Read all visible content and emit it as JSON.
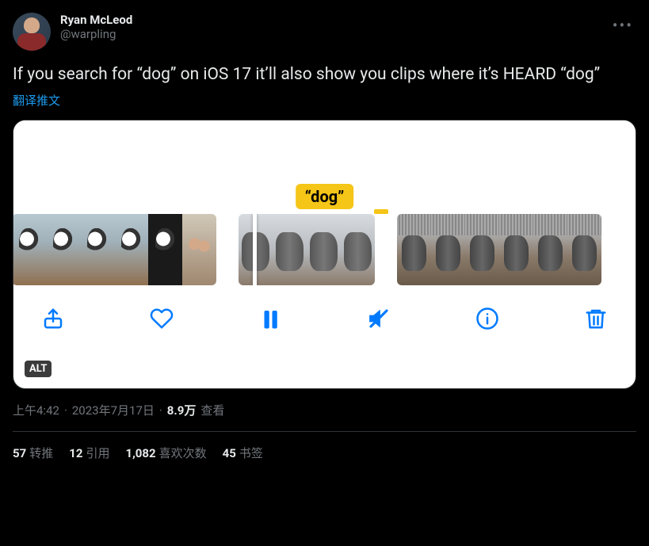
{
  "user": {
    "display_name": "Ryan McLeod",
    "handle": "@warpling"
  },
  "tweet_text": "If you search for “dog” on iOS 17 it’ll also show you clips where it’s HEARD “dog”",
  "translate_label": "翻译推文",
  "media": {
    "caption_tag": "“dog”",
    "alt_badge": "ALT"
  },
  "meta": {
    "time": "上午4:42",
    "separator1": " · ",
    "date": "2023年7月17日",
    "separator2": " · ",
    "views_count": "8.9万",
    "views_label": " 查看"
  },
  "stats": {
    "retweets": {
      "count": "57",
      "label": "转推"
    },
    "quotes": {
      "count": "12",
      "label": "引用"
    },
    "likes": {
      "count": "1,082",
      "label": "喜欢次数"
    },
    "bookmarks": {
      "count": "45",
      "label": "书签"
    }
  },
  "icons": {
    "more": "•••"
  }
}
